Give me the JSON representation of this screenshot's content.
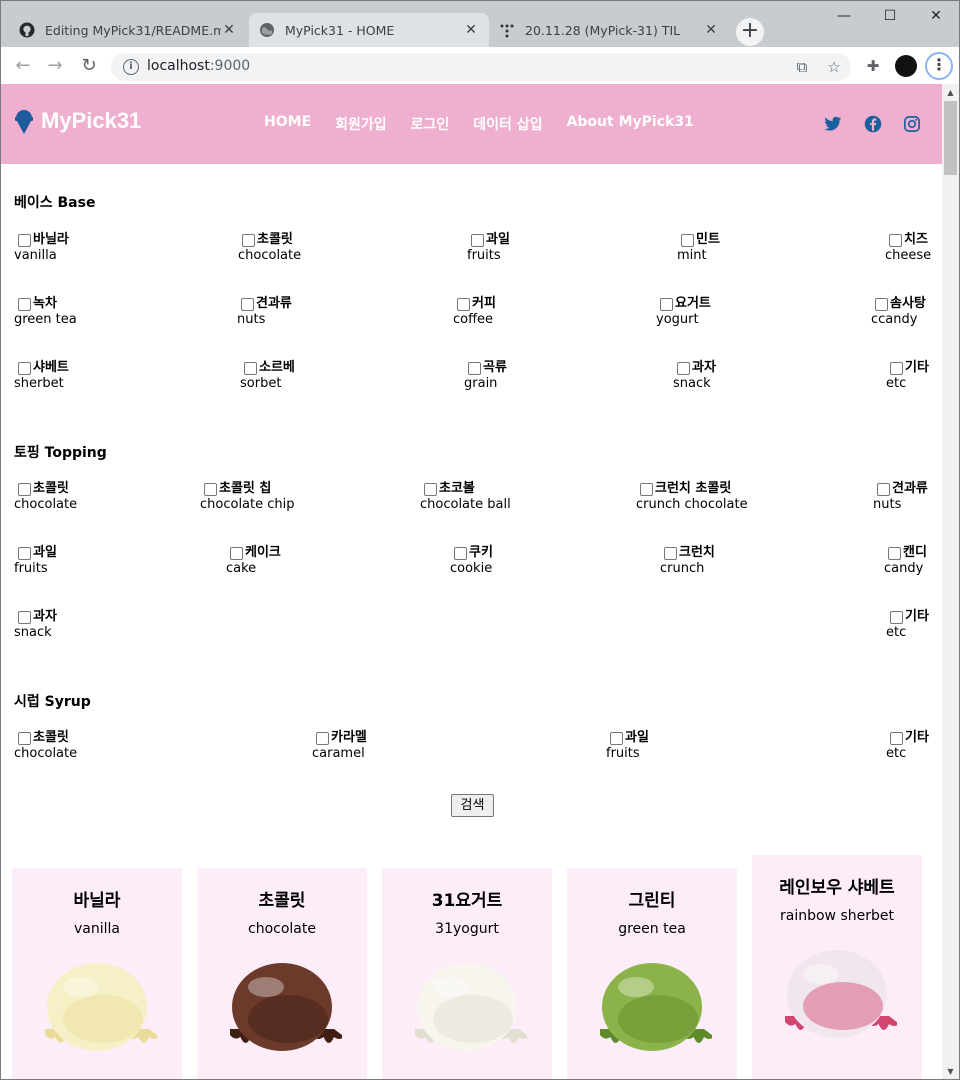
{
  "browser": {
    "tabs": [
      {
        "title": "Editing MyPick31/README.md",
        "favicon": "github-icon",
        "active": false
      },
      {
        "title": "MyPick31 - HOME",
        "favicon": "globe-icon",
        "active": true
      },
      {
        "title": "20.11.28 (MyPick-31) TIL",
        "favicon": "dots-icon",
        "active": false
      }
    ],
    "url_host": "localhost",
    "url_port": ":9000",
    "new_tab": "+",
    "window": {
      "minimize": "—",
      "maximize": "☐",
      "close": "✕"
    }
  },
  "site": {
    "logo_text": "MyPick31",
    "logo_icon": "ice-cream-cone-icon",
    "nav": [
      "HOME",
      "회원가입",
      "로그인",
      "데이터 삽입",
      "About MyPick31"
    ],
    "social": [
      "twitter-icon",
      "facebook-icon",
      "instagram-icon"
    ],
    "colors": {
      "header_bg": "#efafcf",
      "card_bg": "#fcedf9",
      "social": "#1a5f9e"
    }
  },
  "filters": {
    "base": {
      "title": "베이스 Base",
      "options": [
        {
          "kr": "바닐라",
          "en": "vanilla"
        },
        {
          "kr": "초콜릿",
          "en": "chocolate"
        },
        {
          "kr": "과일",
          "en": "fruits"
        },
        {
          "kr": "민트",
          "en": "mint"
        },
        {
          "kr": "치즈",
          "en": "cheese"
        },
        {
          "kr": "녹차",
          "en": "green tea"
        },
        {
          "kr": "견과류",
          "en": "nuts"
        },
        {
          "kr": "커피",
          "en": "coffee"
        },
        {
          "kr": "요거트",
          "en": "yogurt"
        },
        {
          "kr": "솜사탕",
          "en": "ccandy"
        },
        {
          "kr": "샤베트",
          "en": "sherbet"
        },
        {
          "kr": "소르베",
          "en": "sorbet"
        },
        {
          "kr": "곡류",
          "en": "grain"
        },
        {
          "kr": "과자",
          "en": "snack"
        },
        {
          "kr": "기타",
          "en": "etc"
        }
      ]
    },
    "topping": {
      "title": "토핑 Topping",
      "options": [
        {
          "kr": "초콜릿",
          "en": "chocolate"
        },
        {
          "kr": "초콜릿 칩",
          "en": "chocolate chip"
        },
        {
          "kr": "초코볼",
          "en": "chocolate ball"
        },
        {
          "kr": "크런치 초콜릿",
          "en": "crunch chocolate"
        },
        {
          "kr": "견과류",
          "en": "nuts"
        },
        {
          "kr": "과일",
          "en": "fruits"
        },
        {
          "kr": "케이크",
          "en": "cake"
        },
        {
          "kr": "쿠키",
          "en": "cookie"
        },
        {
          "kr": "크런치",
          "en": "crunch"
        },
        {
          "kr": "캔디",
          "en": "candy"
        },
        {
          "kr": "과자",
          "en": "snack"
        },
        {
          "kr": "기타",
          "en": "etc"
        }
      ]
    },
    "syrup": {
      "title": "시럽 Syrup",
      "options": [
        {
          "kr": "초콜릿",
          "en": "chocolate"
        },
        {
          "kr": "카라멜",
          "en": "caramel"
        },
        {
          "kr": "과일",
          "en": "fruits"
        },
        {
          "kr": "기타",
          "en": "etc"
        }
      ]
    },
    "search_label": "검색"
  },
  "cards": [
    {
      "kr": "바닐라",
      "en": "vanilla",
      "scoop_color": "#f6f0c6",
      "shade_color": "#e8dc97"
    },
    {
      "kr": "초콜릿",
      "en": "chocolate",
      "scoop_color": "#6b3a2a",
      "shade_color": "#3f1f15"
    },
    {
      "kr": "31요거트",
      "en": "31yogurt",
      "scoop_color": "#f7f5ee",
      "shade_color": "#e2ded0"
    },
    {
      "kr": "그린티",
      "en": "green tea",
      "scoop_color": "#8cb34a",
      "shade_color": "#5e8a2a"
    },
    {
      "kr": "레인보우 샤베트",
      "en": "rainbow sherbet",
      "scoop_color": "#f2e6ee",
      "shade_color": "#d1466f"
    }
  ]
}
